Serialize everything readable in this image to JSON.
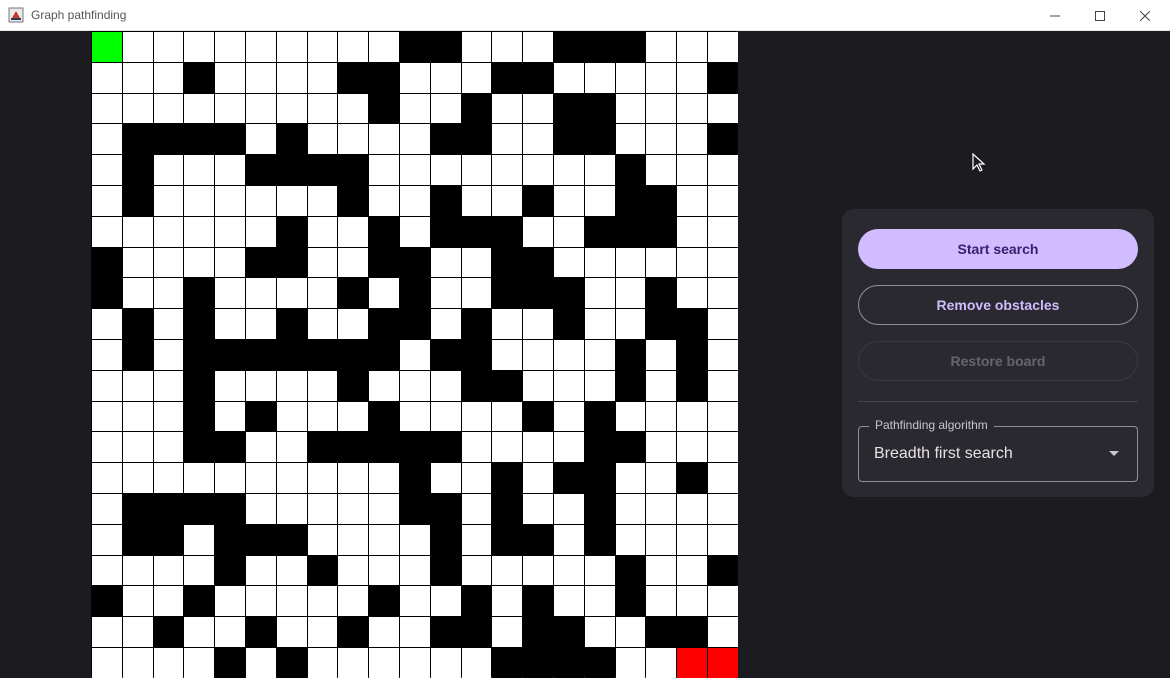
{
  "window": {
    "title": "Graph pathfinding"
  },
  "controls": {
    "start_label": "Start search",
    "remove_label": "Remove obstacles",
    "restore_label": "Restore board"
  },
  "algorithm": {
    "label": "Pathfinding algorithm",
    "selected": "Breadth first search"
  },
  "colors": {
    "start": "#00ff00",
    "end": "#ff0000",
    "wall": "#000000",
    "empty": "#ffffff",
    "accent": "#d0bcff"
  },
  "board": {
    "rows": [
      "S0000000001100011100000",
      "000100001100011000001000",
      "000000000100100110000100",
      "0111101000011001100011100",
      "0100011110000000010000010",
      "01000000100100100110000",
      "00000010010111001110000001",
      "100001100110011000000",
      "100100001010011100100",
      "010100100110100100110",
      "010111111101100001010",
      "000100001000110001010",
      "000101000100001010000",
      "000110011111000011000",
      "000000000010010110010",
      "011110000011010010000",
      "011011100001011010000",
      "000010010001000001001",
      "100100000100101001000",
      "001001001001101100110",
      "0000101000000111100E"
    ]
  }
}
